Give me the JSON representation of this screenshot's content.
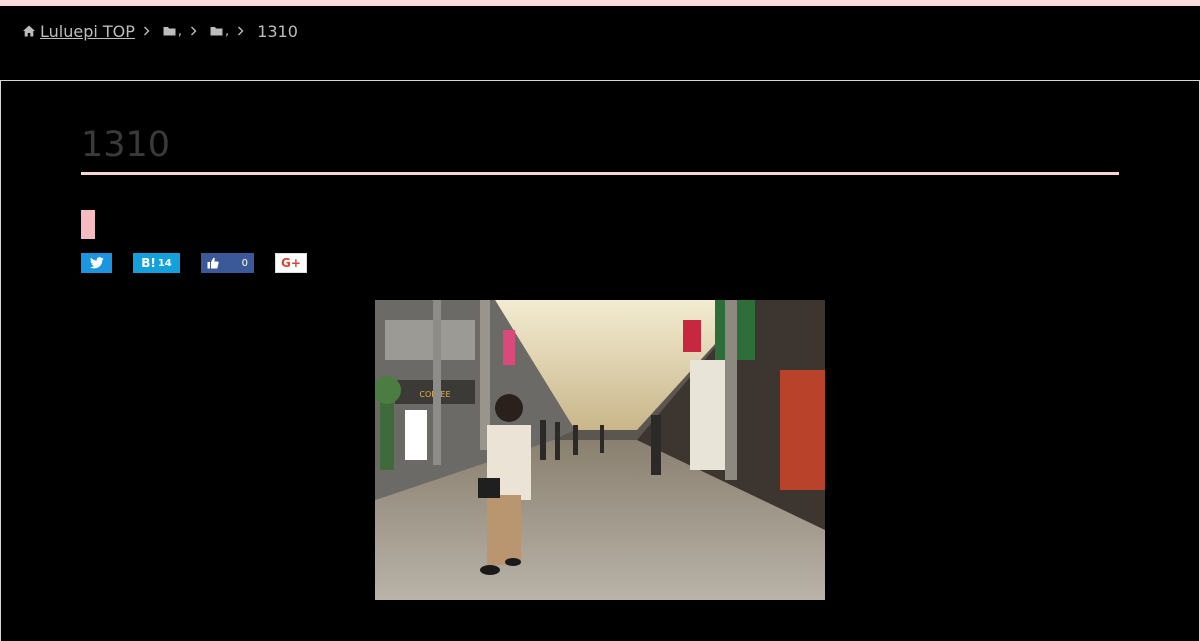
{
  "colors": {
    "background": "#000000",
    "accent_pink": "#f4d6d8",
    "category_tag": "#f4bcc1",
    "twitter": "#1b95e0",
    "hatena": "#13a0dc",
    "facebook": "#3b5998",
    "gplus": "#db4437"
  },
  "breadcrumb": {
    "home_icon": "home-icon",
    "home_label": "Luluepi TOP",
    "folder_icon": "folder-icon",
    "separator_glyph": "›",
    "comma": ",",
    "current": "1310"
  },
  "article": {
    "title": "1310"
  },
  "share": {
    "twitter_icon": "twitter-bird-icon",
    "hatena_label": "B!",
    "hatena_count": "14",
    "facebook_icon": "thumbs-up-icon",
    "facebook_count": "0",
    "gplus_label": "G+"
  },
  "photo": {
    "subject": "shopping-arcade-photo"
  }
}
